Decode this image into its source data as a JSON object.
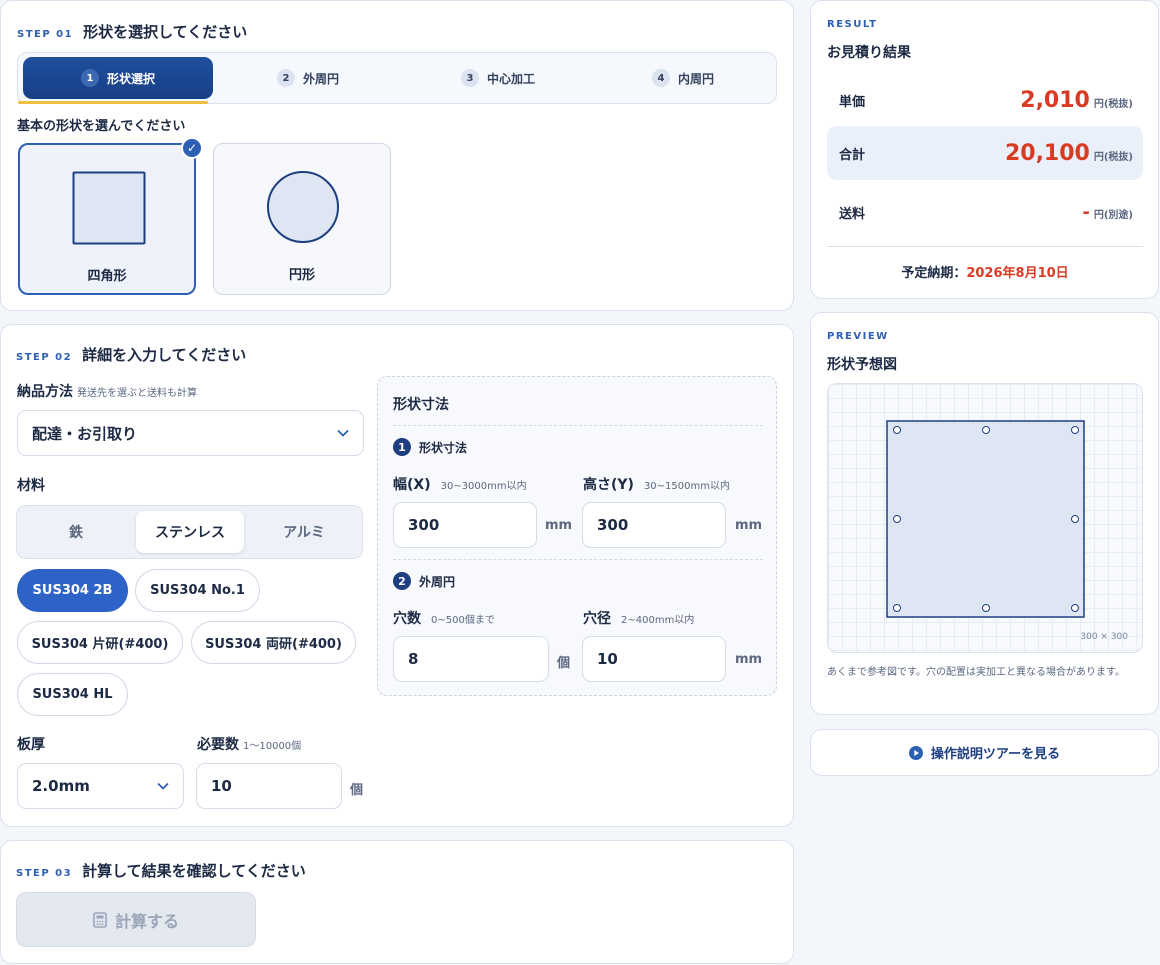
{
  "step1": {
    "step_no": "STEP 01",
    "title": "形状を選択してください",
    "tabs": [
      {
        "num": "1",
        "label": "形状選択"
      },
      {
        "num": "2",
        "label": "外周円"
      },
      {
        "num": "3",
        "label": "中心加工"
      },
      {
        "num": "4",
        "label": "内周円"
      }
    ],
    "shape_prompt": "基本の形状を選んでください",
    "shapes": [
      {
        "label": "四角形",
        "selected": true
      },
      {
        "label": "円形",
        "selected": false
      }
    ],
    "check_icon": "✓"
  },
  "step2": {
    "step_no": "STEP 02",
    "title": "詳細を入力してください",
    "delivery_label": "納品方法",
    "delivery_hint": "発送先を選ぶと送料も計算",
    "delivery_value": "配達・お引取り",
    "material_label": "材料",
    "materials": [
      "鉄",
      "ステンレス",
      "アルミ"
    ],
    "material_selected": "ステンレス",
    "grades": [
      "SUS304 2B",
      "SUS304 No.1",
      "SUS304 片研(#400)",
      "SUS304 両研(#400)",
      "SUS304 HL"
    ],
    "grade_selected": "SUS304 2B",
    "thickness_label": "板厚",
    "thickness_value": "2.0mm",
    "qty_label": "必要数",
    "qty_hint": "1〜10000個",
    "qty_value": "10",
    "qty_unit": "個",
    "dims": {
      "title": "形状寸法",
      "section1": {
        "num": "1",
        "title": "形状寸法"
      },
      "width_label": "幅(X)",
      "width_hint": "30~3000mm以内",
      "width_value": "300",
      "width_unit": "mm",
      "height_label": "高さ(Y)",
      "height_hint": "30~1500mm以内",
      "height_value": "300",
      "height_unit": "mm",
      "section2": {
        "num": "2",
        "title": "外周円"
      },
      "holes_label": "穴数",
      "holes_hint": "0~500個まで",
      "holes_value": "8",
      "holes_unit": "個",
      "diam_label": "穴径",
      "diam_hint": "2~400mm以内",
      "diam_value": "10",
      "diam_unit": "mm"
    }
  },
  "step3": {
    "step_no": "STEP 03",
    "title": "計算して結果を確認してください",
    "calc_label": "計算する"
  },
  "result": {
    "eyebrow": "RESULT",
    "title": "お見積り結果",
    "unit_price_label": "単価",
    "unit_price_value": "2,010",
    "unit_price_unit": "円(税抜)",
    "total_label": "合計",
    "total_value": "20,100",
    "total_unit": "円(税抜)",
    "shipping_label": "送料",
    "shipping_value": "-",
    "shipping_unit": "円(別途)",
    "delivery_label": "予定納期：",
    "delivery_date": "2026年8月10日"
  },
  "preview": {
    "eyebrow": "PREVIEW",
    "title": "形状予想図",
    "size_label": "300 × 300",
    "note": "あくまで参考図です。穴の配置は実加工と異なる場合があります。"
  },
  "tour": {
    "label": "操作説明ツアーを見る"
  },
  "colors": {
    "accent": "#2d5fb3",
    "navy": "#1d3f80",
    "price": "#d93a22",
    "highlight": "#f0c040"
  }
}
